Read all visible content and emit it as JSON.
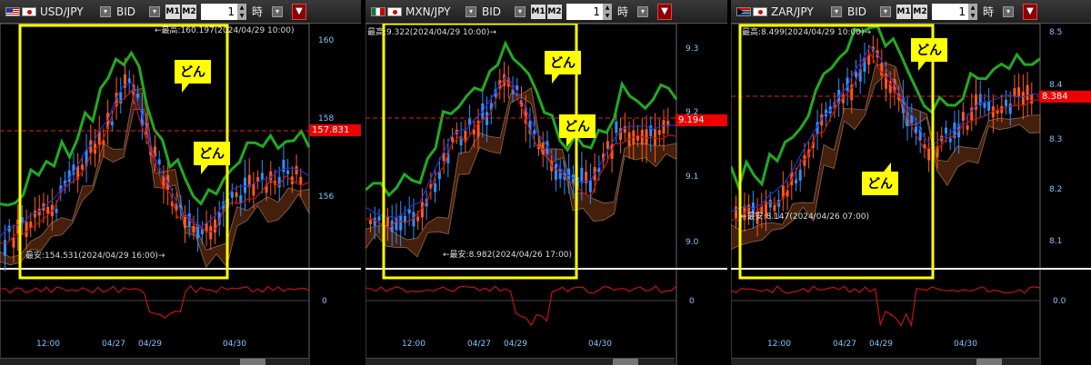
{
  "colors": {
    "candle_up": "#ff5a1e",
    "candle_down": "#2f8fff",
    "tenkan": "#c41414",
    "kijun": "#2233cc",
    "chikou": "#22aa22",
    "cloud": "#5a2a10",
    "highlight": "#ffff00",
    "price_tag": "#e00000"
  },
  "panels": [
    {
      "pair": "USD/JPY",
      "flag": "flag-us",
      "price_type": "BID",
      "m1": "M1",
      "m2": "M2",
      "timeframe_value": "1",
      "timeframe_unit": "時",
      "current_price": "157.831",
      "high_label": "←最高:160.197(2024/04/29 10:00)",
      "low_label": "最安:154.531(2024/04/29 16:00)→",
      "y_ticks": [
        "160",
        "158",
        "156"
      ],
      "sub_tick": "0",
      "x_ticks": [
        "12:00",
        "04/27",
        "04/29",
        "04/30"
      ],
      "callouts": [
        "どん",
        "どん"
      ]
    },
    {
      "pair": "MXN/JPY",
      "flag": "flag-mx",
      "price_type": "BID",
      "m1": "M1",
      "m2": "M2",
      "timeframe_value": "1",
      "timeframe_unit": "時",
      "current_price": "9.194",
      "high_label": "最高:9.322(2024/04/29 10:00)→",
      "low_label": "←最安:8.982(2024/04/26 17:00)",
      "y_ticks": [
        "9.3",
        "9.2",
        "9.1",
        "9.0"
      ],
      "sub_tick": "0",
      "x_ticks": [
        "12:00",
        "04/27",
        "04/29",
        "04/30"
      ],
      "callouts": [
        "どん",
        "どん"
      ]
    },
    {
      "pair": "ZAR/JPY",
      "flag": "flag-za",
      "price_type": "BID",
      "m1": "M1",
      "m2": "M2",
      "timeframe_value": "1",
      "timeframe_unit": "時",
      "current_price": "8.384",
      "high_label": "最高:8.499(2024/04/29 10:00)→",
      "low_label": "←最安:8.147(2024/04/26 07:00)",
      "y_ticks": [
        "8.5",
        "8.4",
        "8.3",
        "8.2",
        "8.1"
      ],
      "sub_tick": "0.0",
      "x_ticks": [
        "12:00",
        "04/27",
        "04/29",
        "04/30"
      ],
      "callouts": [
        "どん",
        "どん"
      ]
    }
  ]
}
